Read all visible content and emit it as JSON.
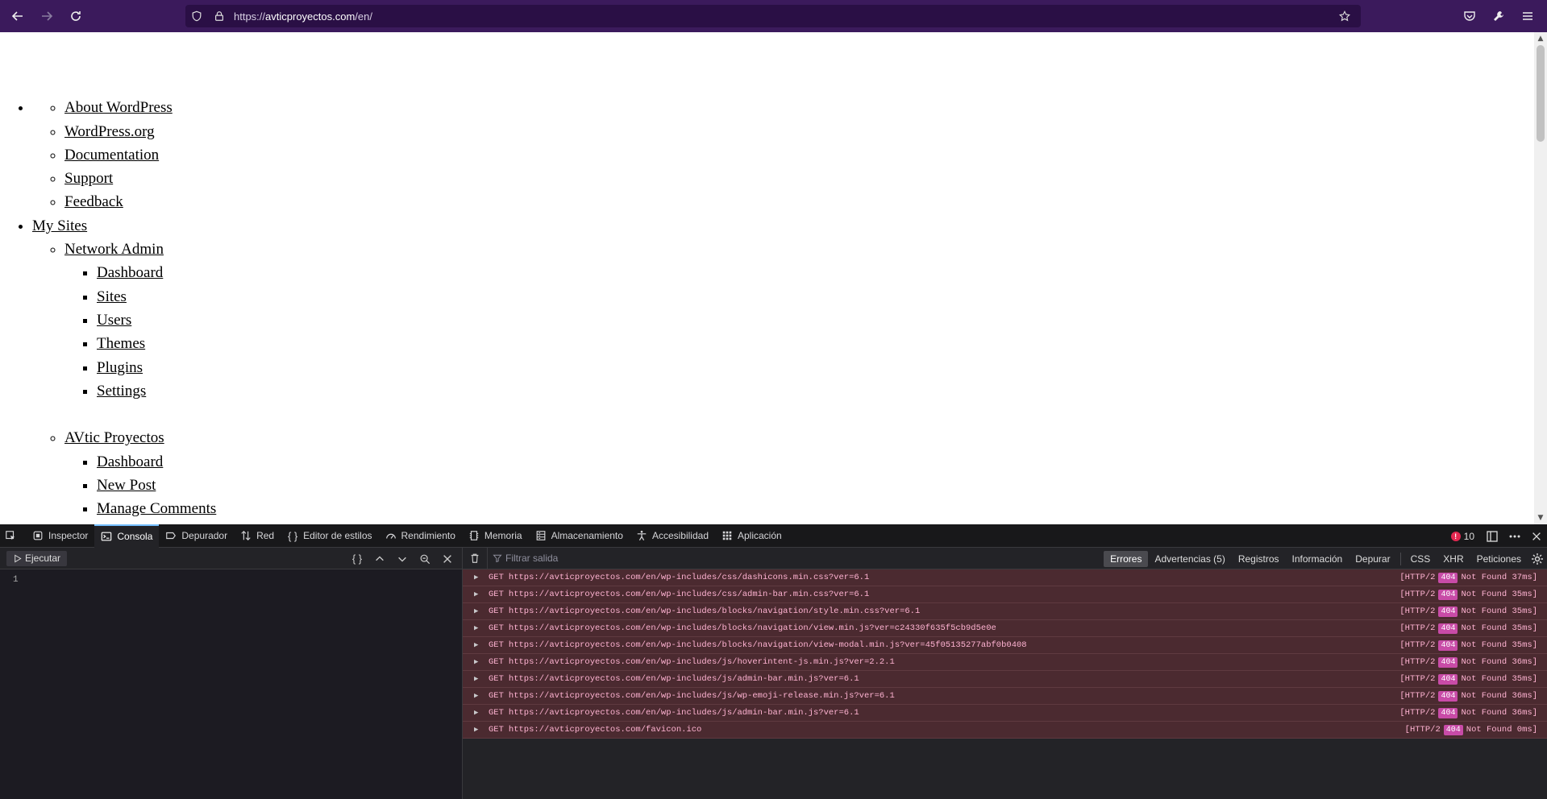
{
  "browser": {
    "url_prefix": "https://",
    "url_host": "avticproyectos.com",
    "url_path": "/en/"
  },
  "page": {
    "sections": [
      {
        "label": "",
        "children": [
          {
            "label": "About WordPress"
          },
          {
            "label": "WordPress.org"
          },
          {
            "label": "Documentation"
          },
          {
            "label": "Support"
          },
          {
            "label": "Feedback"
          }
        ]
      },
      {
        "label": "My Sites",
        "children": [
          {
            "label": "Network Admin",
            "children": [
              "Dashboard",
              "Sites",
              "Users",
              "Themes",
              "Plugins",
              "Settings"
            ]
          },
          {
            "label": "AVtic Proyectos",
            "children": [
              "Dashboard",
              "New Post",
              "Manage Comments"
            ]
          }
        ]
      }
    ]
  },
  "devtools": {
    "tabs": [
      {
        "label": "Inspector",
        "icon": "inspector-icon"
      },
      {
        "label": "Consola",
        "icon": "console-icon",
        "active": true
      },
      {
        "label": "Depurador",
        "icon": "debugger-icon"
      },
      {
        "label": "Red",
        "icon": "network-icon"
      },
      {
        "label": "Editor de estilos",
        "icon": "braces-icon"
      },
      {
        "label": "Rendimiento",
        "icon": "gauge-icon"
      },
      {
        "label": "Memoria",
        "icon": "memory-icon"
      },
      {
        "label": "Almacenamiento",
        "icon": "storage-icon"
      },
      {
        "label": "Accesibilidad",
        "icon": "accessibility-icon"
      },
      {
        "label": "Aplicación",
        "icon": "application-icon"
      }
    ],
    "error_count": "10",
    "run_label": "Ejecutar",
    "line_number": "1",
    "filter_placeholder": "Filtrar salida",
    "levels": [
      {
        "label": "Errores",
        "active": true
      },
      {
        "label": "Advertencias (5)"
      },
      {
        "label": "Registros"
      },
      {
        "label": "Información"
      },
      {
        "label": "Depurar"
      }
    ],
    "types": [
      "CSS",
      "XHR",
      "Peticiones"
    ],
    "messages": [
      {
        "method": "GET",
        "url": "https://avticproyectos.com/en/wp-includes/css/dashicons.min.css?ver=6.1",
        "proto": "[HTTP/2",
        "code": "404",
        "text": "Not Found 37ms]"
      },
      {
        "method": "GET",
        "url": "https://avticproyectos.com/en/wp-includes/css/admin-bar.min.css?ver=6.1",
        "proto": "[HTTP/2",
        "code": "404",
        "text": "Not Found 35ms]"
      },
      {
        "method": "GET",
        "url": "https://avticproyectos.com/en/wp-includes/blocks/navigation/style.min.css?ver=6.1",
        "proto": "[HTTP/2",
        "code": "404",
        "text": "Not Found 35ms]"
      },
      {
        "method": "GET",
        "url": "https://avticproyectos.com/en/wp-includes/blocks/navigation/view.min.js?ver=c24330f635f5cb9d5e0e",
        "proto": "[HTTP/2",
        "code": "404",
        "text": "Not Found 35ms]"
      },
      {
        "method": "GET",
        "url": "https://avticproyectos.com/en/wp-includes/blocks/navigation/view-modal.min.js?ver=45f05135277abf0b0408",
        "proto": "[HTTP/2",
        "code": "404",
        "text": "Not Found 35ms]"
      },
      {
        "method": "GET",
        "url": "https://avticproyectos.com/en/wp-includes/js/hoverintent-js.min.js?ver=2.2.1",
        "proto": "[HTTP/2",
        "code": "404",
        "text": "Not Found 36ms]"
      },
      {
        "method": "GET",
        "url": "https://avticproyectos.com/en/wp-includes/js/admin-bar.min.js?ver=6.1",
        "proto": "[HTTP/2",
        "code": "404",
        "text": "Not Found 35ms]"
      },
      {
        "method": "GET",
        "url": "https://avticproyectos.com/en/wp-includes/js/wp-emoji-release.min.js?ver=6.1",
        "proto": "[HTTP/2",
        "code": "404",
        "text": "Not Found 36ms]"
      },
      {
        "method": "GET",
        "url": "https://avticproyectos.com/en/wp-includes/js/admin-bar.min.js?ver=6.1",
        "proto": "[HTTP/2",
        "code": "404",
        "text": "Not Found 36ms]"
      },
      {
        "method": "GET",
        "url": "https://avticproyectos.com/favicon.ico",
        "proto": "[HTTP/2",
        "code": "404",
        "text": "Not Found 0ms]"
      }
    ]
  }
}
